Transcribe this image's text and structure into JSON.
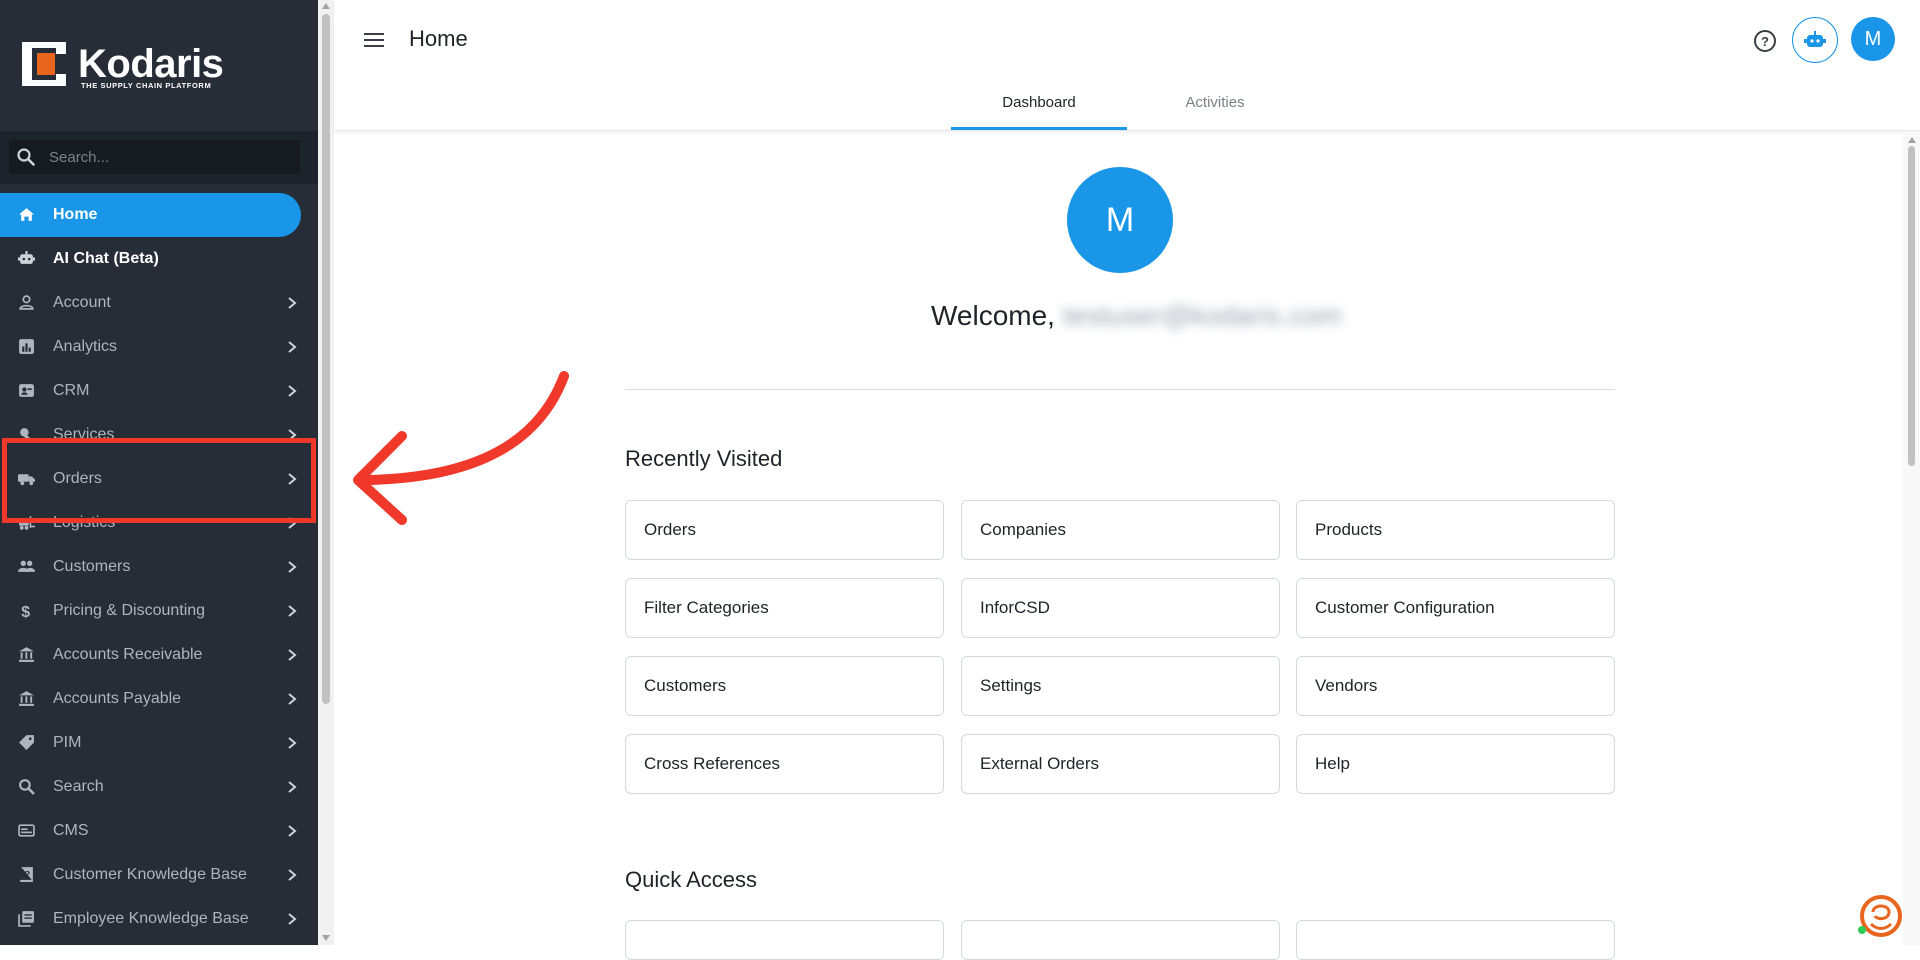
{
  "brand": {
    "name": "Kodaris",
    "tagline": "THE SUPPLY CHAIN PLATFORM",
    "accent_color": "#1a96e8",
    "logo_orange": "#e8651e"
  },
  "search": {
    "placeholder": "Search..."
  },
  "sidebar": {
    "items": [
      {
        "label": "Home",
        "icon": "home-icon",
        "active": true
      },
      {
        "label": "AI Chat (Beta)",
        "icon": "robot-icon",
        "bold": true
      },
      {
        "label": "Account",
        "icon": "person-icon",
        "chevron": true
      },
      {
        "label": "Analytics",
        "icon": "chart-icon",
        "chevron": true
      },
      {
        "label": "CRM",
        "icon": "contact-card-icon",
        "chevron": true
      },
      {
        "label": "Services",
        "icon": "wrench-icon",
        "chevron": true
      },
      {
        "label": "Orders",
        "icon": "truck-icon",
        "chevron": true
      },
      {
        "label": "Logistics",
        "icon": "forklift-icon",
        "chevron": true
      },
      {
        "label": "Customers",
        "icon": "group-icon",
        "chevron": true
      },
      {
        "label": "Pricing & Discounting",
        "icon": "dollar-icon",
        "chevron": true
      },
      {
        "label": "Accounts Receivable",
        "icon": "bank-icon",
        "chevron": true
      },
      {
        "label": "Accounts Payable",
        "icon": "bank-icon",
        "chevron": true
      },
      {
        "label": "PIM",
        "icon": "tag-icon",
        "chevron": true
      },
      {
        "label": "Search",
        "icon": "search-icon",
        "chevron": true
      },
      {
        "label": "CMS",
        "icon": "cms-icon",
        "chevron": true
      },
      {
        "label": "Customer Knowledge Base",
        "icon": "help-book-icon",
        "chevron": true
      },
      {
        "label": "Employee Knowledge Base",
        "icon": "library-icon",
        "chevron": true
      }
    ]
  },
  "header": {
    "title": "Home",
    "avatar_initial": "M",
    "tabs": [
      "Dashboard",
      "Activities"
    ],
    "active_tab": "Dashboard"
  },
  "main": {
    "avatar_initial": "M",
    "welcome": "Welcome,",
    "welcome_email": "testuser@kodaris.com",
    "recently_visited_title": "Recently Visited",
    "recently_visited": [
      "Orders",
      "Companies",
      "Products",
      "Filter Categories",
      "InforCSD",
      "Customer Configuration",
      "Customers",
      "Settings",
      "Vendors",
      "Cross References",
      "External Orders",
      "Help"
    ],
    "quick_access_title": "Quick Access"
  },
  "annotation": {
    "highlight_color": "#f0382b",
    "highlighted_item": "Orders"
  }
}
